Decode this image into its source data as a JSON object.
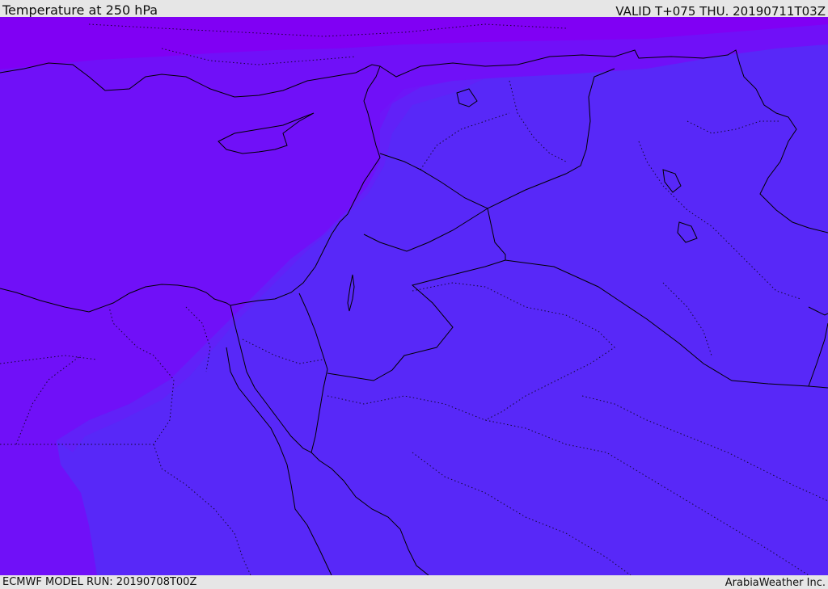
{
  "header": {
    "title": "Temperature at 250 hPa",
    "valid": "VALID T+075 THU. 20190711T03Z"
  },
  "footer": {
    "model_run": "ECMWF MODEL RUN: 20190708T00Z",
    "credit": "ArabiaWeather Inc."
  },
  "colors": {
    "band_coldest": "#8000f4",
    "band_cold": "#7010f8",
    "band_main": "#5828f8",
    "coastline": "#000000",
    "page_bg": "#e6e6e6"
  }
}
